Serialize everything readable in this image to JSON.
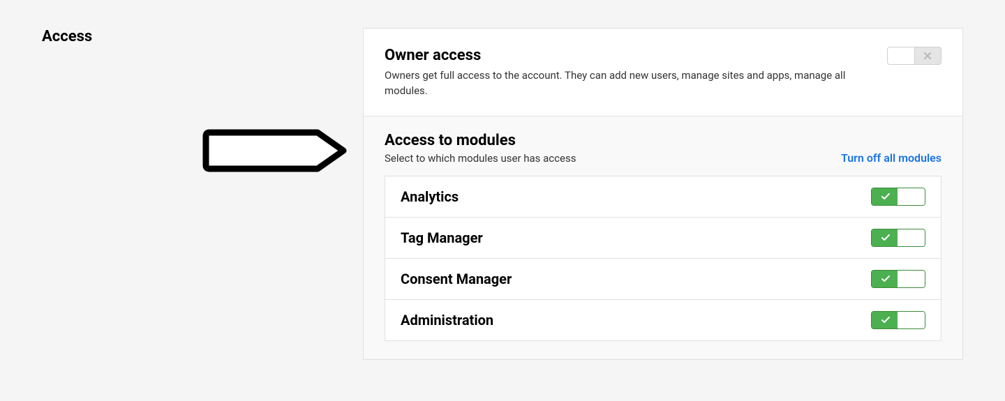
{
  "section_title": "Access",
  "owner": {
    "title": "Owner access",
    "description": "Owners get full access to the account. They can add new users, manage sites and apps, manage all modules.",
    "enabled": false
  },
  "modules_section": {
    "title": "Access to modules",
    "subtitle": "Select to which modules user has access",
    "turn_off_label": "Turn off all modules"
  },
  "modules": [
    {
      "name": "Analytics",
      "enabled": true
    },
    {
      "name": "Tag Manager",
      "enabled": true
    },
    {
      "name": "Consent Manager",
      "enabled": true
    },
    {
      "name": "Administration",
      "enabled": true
    }
  ]
}
